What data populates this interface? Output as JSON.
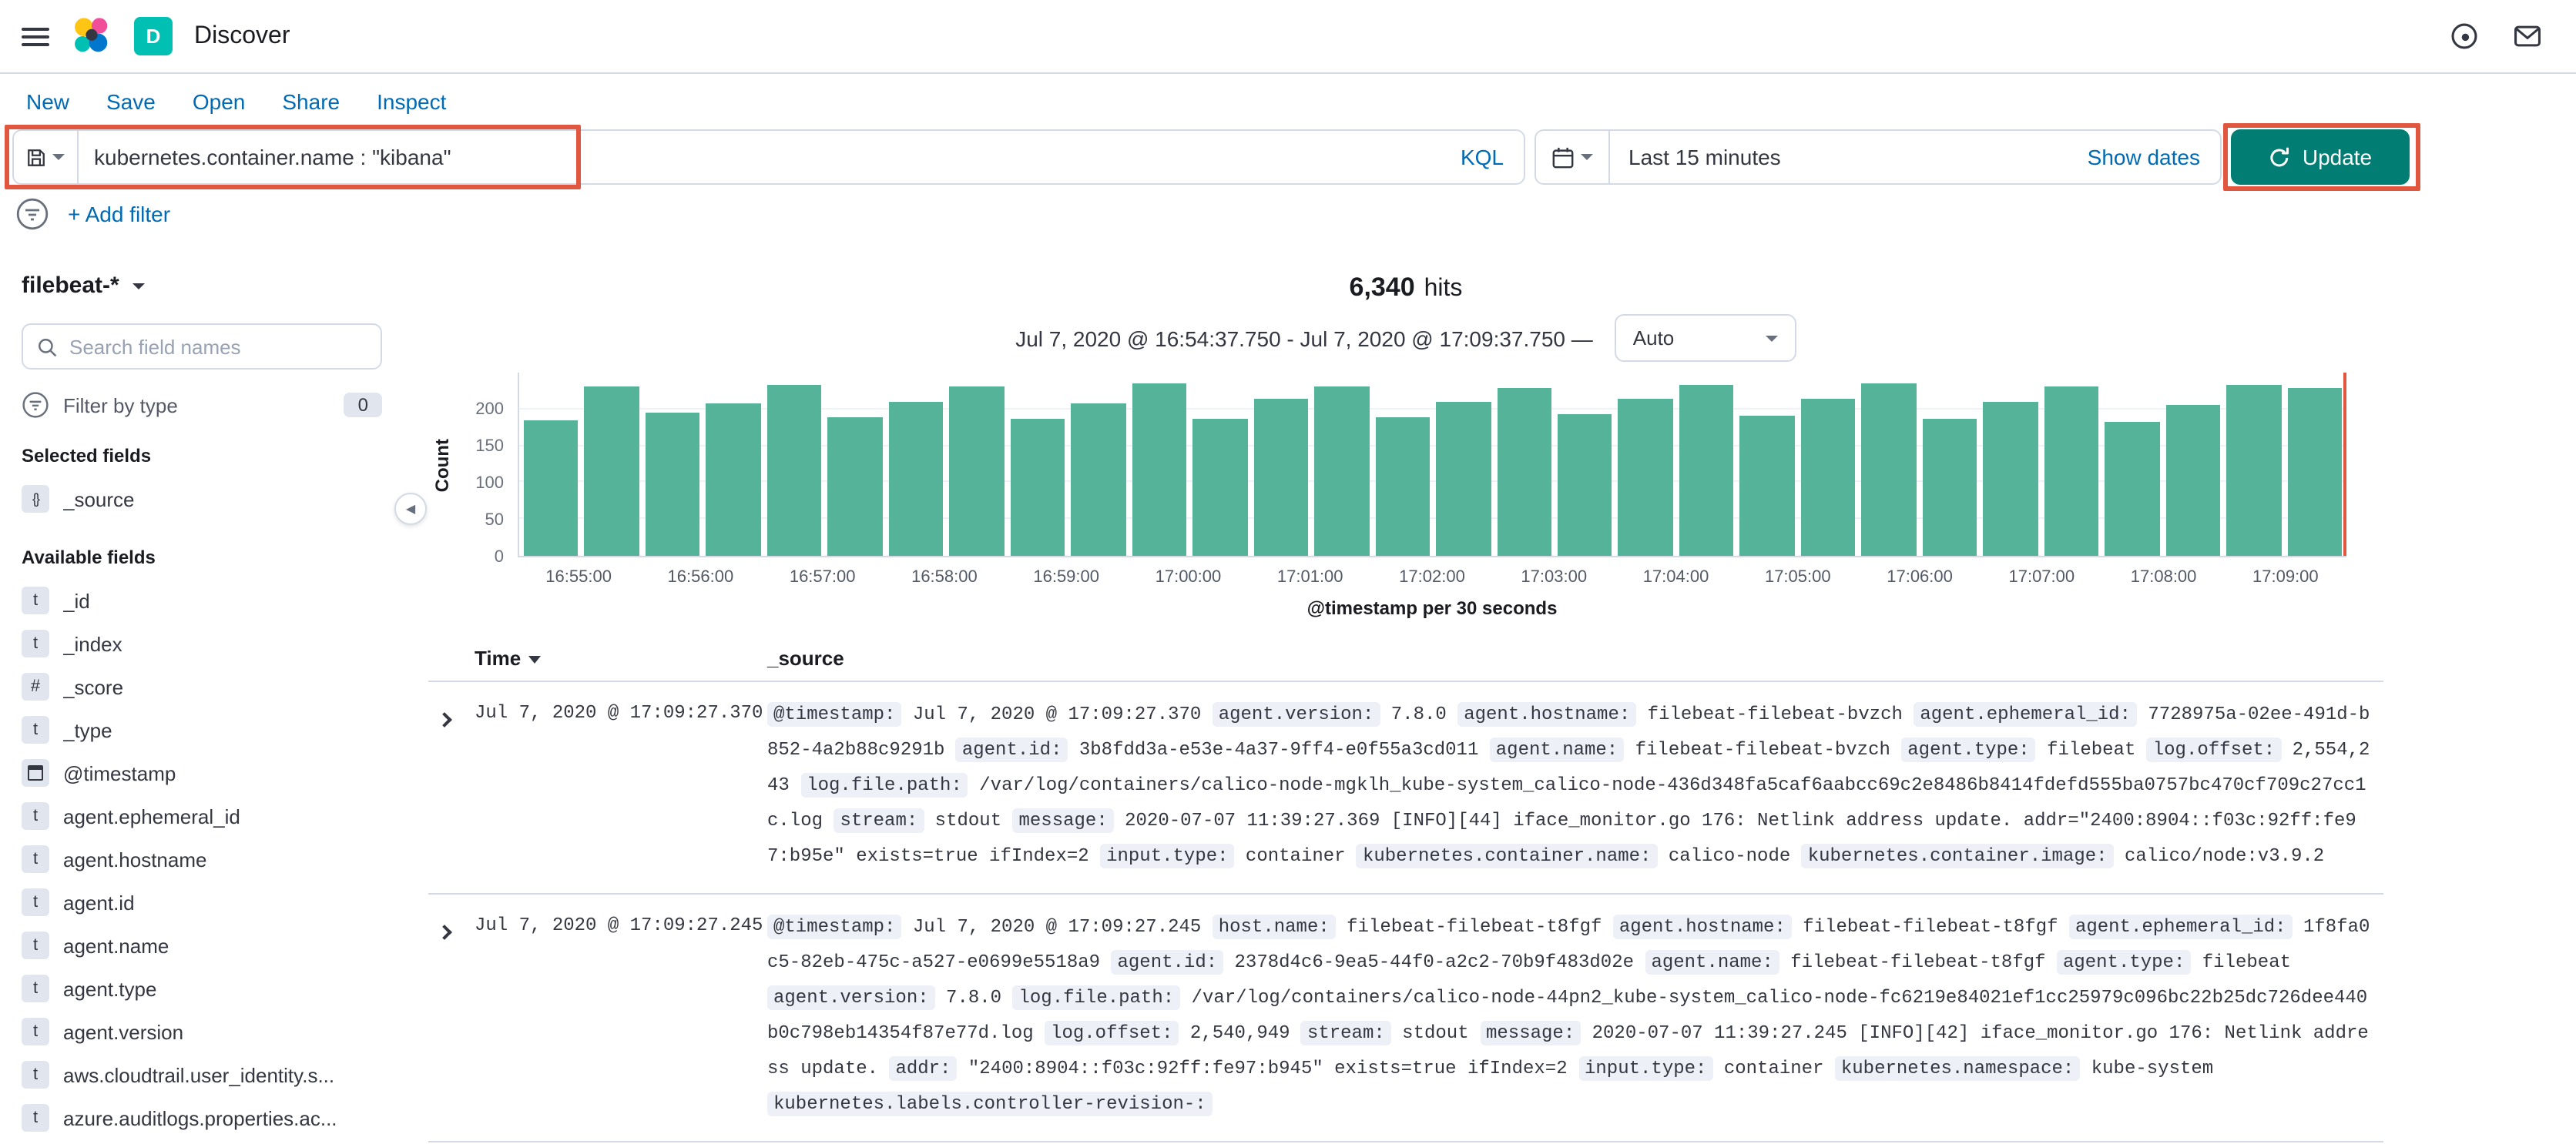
{
  "colors": {
    "link": "#006BB4",
    "bar": "#54B399",
    "update": "#017D73",
    "annotation": "#E0563F",
    "badge_teal": "#00BFB3"
  },
  "header": {
    "app_badge": "D",
    "title": "Discover"
  },
  "menu": {
    "items": [
      "New",
      "Save",
      "Open",
      "Share",
      "Inspect"
    ]
  },
  "query_bar": {
    "query": "kubernetes.container.name : \"kibana\"",
    "language": "KQL",
    "time_range": "Last 15 minutes",
    "show_dates_label": "Show dates",
    "update_label": "Update"
  },
  "filter_bar": {
    "add_filter_label": "+ Add filter"
  },
  "sidebar": {
    "index_pattern": "filebeat-*",
    "search_placeholder": "Search field names",
    "filter_by_type_label": "Filter by type",
    "filter_count": "0",
    "selected_fields_label": "Selected fields",
    "selected_fields": [
      {
        "name": "_source",
        "type": "source"
      }
    ],
    "available_fields_label": "Available fields",
    "available_fields": [
      {
        "name": "_id",
        "type": "t"
      },
      {
        "name": "_index",
        "type": "t"
      },
      {
        "name": "_score",
        "type": "#"
      },
      {
        "name": "_type",
        "type": "t"
      },
      {
        "name": "@timestamp",
        "type": "date"
      },
      {
        "name": "agent.ephemeral_id",
        "type": "t"
      },
      {
        "name": "agent.hostname",
        "type": "t"
      },
      {
        "name": "agent.id",
        "type": "t"
      },
      {
        "name": "agent.name",
        "type": "t"
      },
      {
        "name": "agent.type",
        "type": "t"
      },
      {
        "name": "agent.version",
        "type": "t"
      },
      {
        "name": "aws.cloudtrail.user_identity.s...",
        "type": "t"
      },
      {
        "name": "azure.auditlogs.properties.ac...",
        "type": "t"
      }
    ]
  },
  "results": {
    "hits_count": "6,340",
    "hits_label": "hits",
    "date_range": "Jul 7, 2020 @ 16:54:37.750 - Jul 7, 2020 @ 17:09:37.750 —",
    "interval_label": "Auto"
  },
  "chart_data": {
    "type": "bar",
    "title": "6,340 hits",
    "xlabel": "@timestamp per 30 seconds",
    "ylabel": "Count",
    "ylim": [
      0,
      250
    ],
    "yticks": [
      0,
      50,
      100,
      150,
      200
    ],
    "x_tick_labels": [
      "16:55:00",
      "16:56:00",
      "16:57:00",
      "16:58:00",
      "16:59:00",
      "17:00:00",
      "17:01:00",
      "17:02:00",
      "17:03:00",
      "17:04:00",
      "17:05:00",
      "17:06:00",
      "17:07:00",
      "17:08:00",
      "17:09:00"
    ],
    "values": [
      185,
      231,
      196,
      209,
      233,
      190,
      211,
      231,
      188,
      209,
      236,
      187,
      214,
      232,
      190,
      211,
      229,
      194,
      215,
      233,
      192,
      214,
      236,
      188,
      211,
      231,
      183,
      206,
      234,
      228
    ],
    "legend": "off",
    "grid": "on"
  },
  "table": {
    "columns": [
      "Time",
      "_source"
    ],
    "rows": [
      {
        "time": "Jul 7, 2020 @ 17:09:27.370",
        "fields": [
          [
            "@timestamp",
            "Jul 7, 2020 @ 17:09:27.370"
          ],
          [
            "agent.version",
            "7.8.0"
          ],
          [
            "agent.hostname",
            "filebeat-filebeat-bvzch"
          ],
          [
            "agent.ephemeral_id",
            "7728975a-02ee-491d-b852-4a2b88c9291b"
          ],
          [
            "agent.id",
            "3b8fdd3a-e53e-4a37-9ff4-e0f55a3cd011"
          ],
          [
            "agent.name",
            "filebeat-filebeat-bvzch"
          ],
          [
            "agent.type",
            "filebeat"
          ],
          [
            "log.offset",
            "2,554,243"
          ],
          [
            "log.file.path",
            "/var/log/containers/calico-node-mgklh_kube-system_calico-node-436d348fa5caf6aabcc69c2e8486b8414fdefd555ba0757bc470cf709c27cc1c.log"
          ],
          [
            "stream",
            "stdout"
          ],
          [
            "message",
            "2020-07-07 11:39:27.369 [INFO][44] iface_monitor.go 176: Netlink address update. addr=\"2400:8904::f03c:92ff:fe97:b95e\" exists=true ifIndex=2"
          ],
          [
            "input.type",
            "container"
          ],
          [
            "kubernetes.container.name",
            "calico-node"
          ],
          [
            "kubernetes.container.image",
            "calico/node:v3.9.2"
          ]
        ]
      },
      {
        "time": "Jul 7, 2020 @ 17:09:27.245",
        "fields": [
          [
            "@timestamp",
            "Jul 7, 2020 @ 17:09:27.245"
          ],
          [
            "host.name",
            "filebeat-filebeat-t8fgf"
          ],
          [
            "agent.hostname",
            "filebeat-filebeat-t8fgf"
          ],
          [
            "agent.ephemeral_id",
            "1f8fa0c5-82eb-475c-a527-e0699e5518a9"
          ],
          [
            "agent.id",
            "2378d4c6-9ea5-44f0-a2c2-70b9f483d02e"
          ],
          [
            "agent.name",
            "filebeat-filebeat-t8fgf"
          ],
          [
            "agent.type",
            "filebeat"
          ],
          [
            "agent.version",
            "7.8.0"
          ],
          [
            "log.file.path",
            "/var/log/containers/calico-node-44pn2_kube-system_calico-node-fc6219e84021ef1cc25979c096bc22b25dc726dee440b0c798eb14354f87e77d.log"
          ],
          [
            "log.offset",
            "2,540,949"
          ],
          [
            "stream",
            "stdout"
          ],
          [
            "message",
            "2020-07-07 11:39:27.245 [INFO][42] iface_monitor.go 176: Netlink address update."
          ],
          [
            "addr",
            "\"2400:8904::f03c:92ff:fe97:b945\" exists=true ifIndex=2"
          ],
          [
            "input.type",
            "container"
          ],
          [
            "kubernetes.namespace",
            "kube-system"
          ],
          [
            "kubernetes.labels.controller-revision-",
            ""
          ]
        ]
      }
    ]
  }
}
